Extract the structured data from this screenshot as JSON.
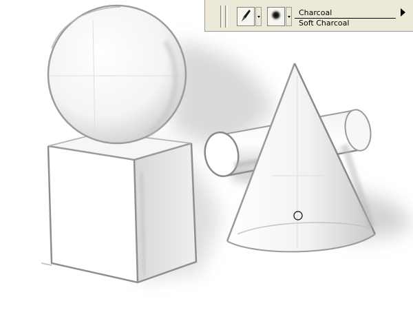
{
  "brush_bar": {
    "brush_category": "Charcoal",
    "brush_variant": "Soft Charcoal",
    "category_icon": "charcoal-stick-icon",
    "variant_icon": "soft-dab-icon",
    "menu_icon": "triangle-right-icon"
  },
  "canvas": {
    "subject": "pencil sketch",
    "cursor": "circle-brush-cursor"
  }
}
